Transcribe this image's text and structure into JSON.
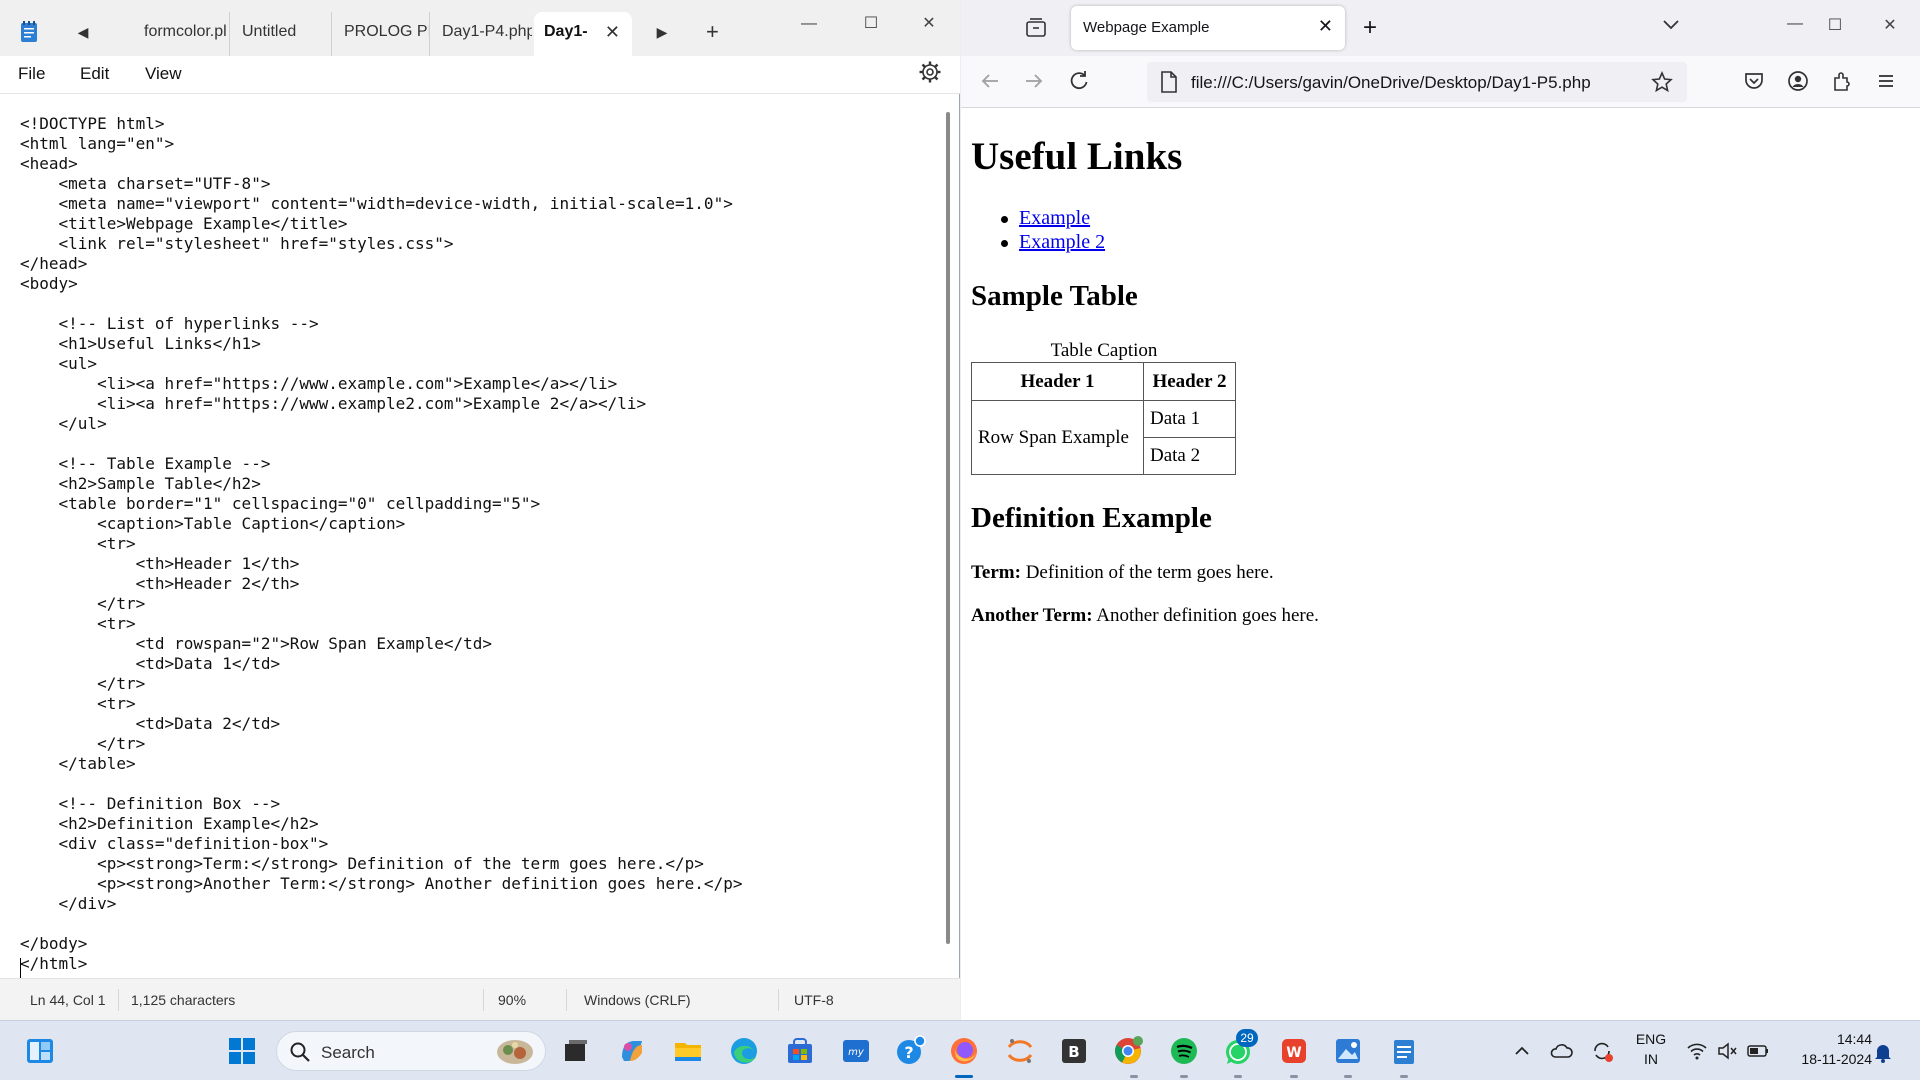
{
  "notepad": {
    "tabs": [
      "formcolor.pl",
      "Untitled",
      "PROLOG PRO",
      "Day1-P4.php",
      "Day1-"
    ],
    "menu": [
      "File",
      "Edit",
      "View"
    ],
    "code_lines": [
      "<!DOCTYPE html>",
      "<html lang=\"en\">",
      "<head>",
      "    <meta charset=\"UTF-8\">",
      "    <meta name=\"viewport\" content=\"width=device-width, initial-scale=1.0\">",
      "    <title>Webpage Example</title>",
      "    <link rel=\"stylesheet\" href=\"styles.css\">",
      "</head>",
      "<body>",
      "",
      "    <!-- List of hyperlinks -->",
      "    <h1>Useful Links</h1>",
      "    <ul>",
      "        <li><a href=\"https://www.example.com\">Example</a></li>",
      "        <li><a href=\"https://www.example2.com\">Example 2</a></li>",
      "    </ul>",
      "",
      "    <!-- Table Example -->",
      "    <h2>Sample Table</h2>",
      "    <table border=\"1\" cellspacing=\"0\" cellpadding=\"5\">",
      "        <caption>Table Caption</caption>",
      "        <tr>",
      "            <th>Header 1</th>",
      "            <th>Header 2</th>",
      "        </tr>",
      "        <tr>",
      "            <td rowspan=\"2\">Row Span Example</td>",
      "            <td>Data 1</td>",
      "        </tr>",
      "        <tr>",
      "            <td>Data 2</td>",
      "        </tr>",
      "    </table>",
      "",
      "    <!-- Definition Box -->",
      "    <h2>Definition Example</h2>",
      "    <div class=\"definition-box\">",
      "        <p><strong>Term:</strong> Definition of the term goes here.</p>",
      "        <p><strong>Another Term:</strong> Another definition goes here.</p>",
      "    </div>",
      "",
      "</body>",
      "</html>"
    ],
    "status": {
      "position": "Ln 44, Col 1",
      "chars": "1,125 characters",
      "zoom": "90%",
      "line_ending": "Windows (CRLF)",
      "encoding": "UTF-8"
    }
  },
  "browser": {
    "tab_title": "Webpage Example",
    "url": "file:///C:/Users/gavin/OneDrive/Desktop/Day1-P5.php",
    "page": {
      "h1": "Useful Links",
      "links": [
        "Example",
        "Example 2"
      ],
      "table_heading": "Sample Table",
      "caption": "Table Caption",
      "headers": [
        "Header 1",
        "Header 2"
      ],
      "rowspan_cell": "Row Span Example",
      "data": [
        "Data 1",
        "Data 2"
      ],
      "def_heading": "Definition Example",
      "terms": [
        {
          "term": "Term:",
          "def": "Definition of the term goes here."
        },
        {
          "term": "Another Term:",
          "def": "Another definition goes here."
        }
      ]
    }
  },
  "taskbar": {
    "search_placeholder": "Search",
    "whatsapp_badge": "29",
    "lang1": "ENG",
    "lang2": "IN",
    "time": "14:44",
    "date": "18-11-2024"
  },
  "icons": [
    "notepad-icon",
    "chevron-left-icon",
    "chevron-right-icon",
    "plus-icon",
    "minimize-icon",
    "maximize-icon",
    "close-icon",
    "gear-icon",
    "tab-overview-icon",
    "list-all-tabs-icon",
    "back-icon",
    "forward-icon",
    "reload-icon",
    "page-icon",
    "bookmark-star-icon",
    "pocket-icon",
    "account-icon",
    "extensions-icon",
    "menu-icon",
    "start-icon",
    "search-icon",
    "task-view-icon",
    "copilot-icon",
    "file-explorer-icon",
    "edge-icon",
    "store-icon",
    "hp-icon",
    "help-icon",
    "firefox-icon",
    "jupyter-icon",
    "b-app-icon",
    "chrome-icon",
    "spotify-icon",
    "whatsapp-icon",
    "office-icon",
    "photos-icon",
    "notepad-taskbar-icon",
    "chevron-up-icon",
    "onedrive-icon",
    "sync-icon",
    "wifi-icon",
    "mute-icon",
    "battery-icon",
    "bell-icon"
  ]
}
